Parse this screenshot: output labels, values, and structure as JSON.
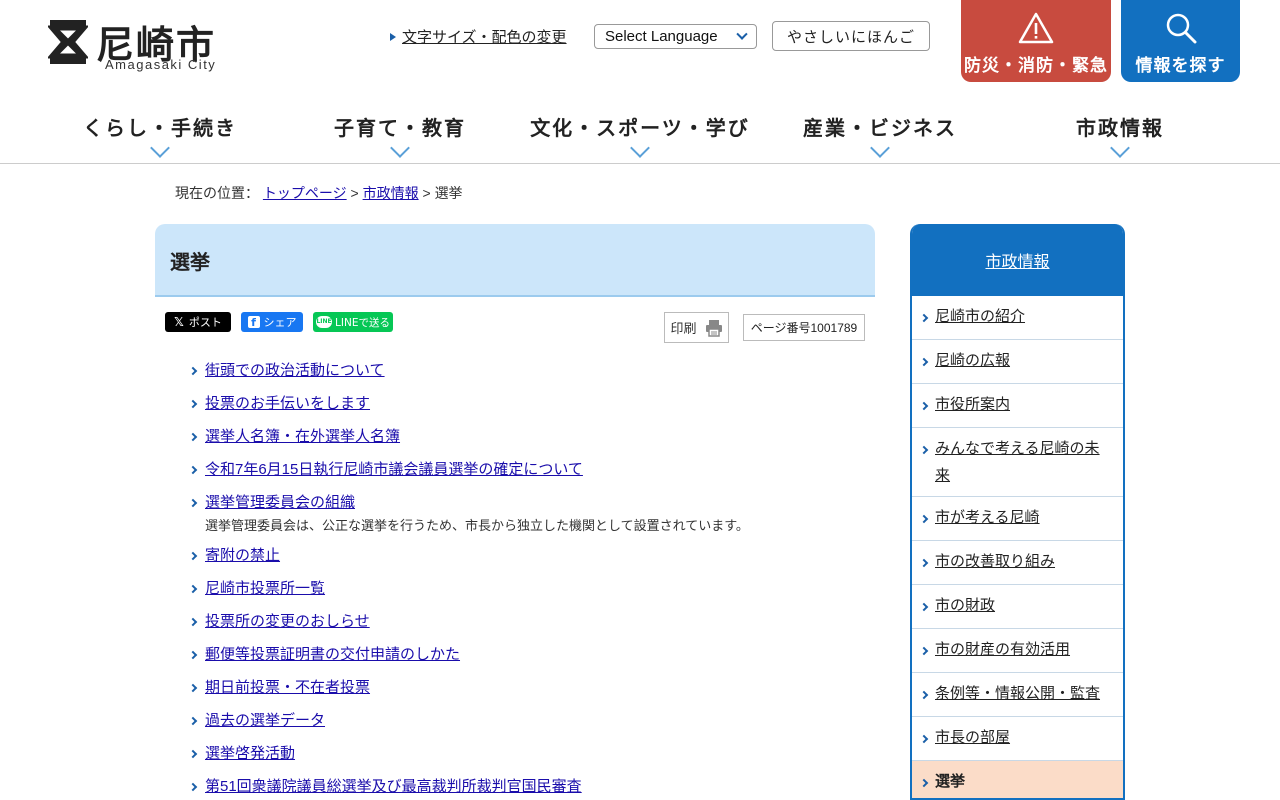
{
  "header": {
    "logo_text": "尼崎市",
    "logo_sub": "Amagasaki City",
    "textsize_link": "文字サイズ・配色の変更",
    "language_select": "Select Language",
    "easy_japanese": "やさしいにほんご",
    "disaster_button": "防災・消防・緊急",
    "search_button": "情報を探す",
    "disaster_color": "#c84b3f",
    "brand_blue": "#1270c0"
  },
  "gnav": [
    {
      "label": "くらし・手続き"
    },
    {
      "label": "子育て・教育"
    },
    {
      "label": "文化・スポーツ・学び"
    },
    {
      "label": "産業・ビジネス"
    },
    {
      "label": "市政情報"
    }
  ],
  "breadcrumb": {
    "prefix": "現在の位置：",
    "top": "トップページ",
    "sep": ">",
    "parent": "市政情報",
    "current": "選挙"
  },
  "main": {
    "title": "選挙",
    "share_x": "ポスト",
    "share_fb": "シェア",
    "share_line": "LINEで送る",
    "print": "印刷",
    "page_number": "ページ番号1001789",
    "links": [
      {
        "label": "街頭での政治活動について"
      },
      {
        "label": "投票のお手伝いをします"
      },
      {
        "label": "選挙人名簿・在外選挙人名簿"
      },
      {
        "label": "令和7年6月15日執行尼崎市議会議員選挙の確定について"
      },
      {
        "label": "選挙管理委員会の組織",
        "desc": "選挙管理委員会は、公正な選挙を行うため、市長から独立した機関として設置されています。"
      },
      {
        "label": "寄附の禁止"
      },
      {
        "label": "尼崎市投票所一覧"
      },
      {
        "label": "投票所の変更のおしらせ"
      },
      {
        "label": "郵便等投票証明書の交付申請のしかた"
      },
      {
        "label": "期日前投票・不在者投票"
      },
      {
        "label": "過去の選挙データ"
      },
      {
        "label": "選挙啓発活動"
      },
      {
        "label": "第51回衆議院議員総選挙及び最高裁判所裁判官国民審査"
      }
    ]
  },
  "sidebar": {
    "heading": "市政情報",
    "items": [
      {
        "label": "尼崎市の紹介"
      },
      {
        "label": "尼崎の広報"
      },
      {
        "label": "市役所案内"
      },
      {
        "label": "みんなで考える尼崎の未来"
      },
      {
        "label": "市が考える尼崎"
      },
      {
        "label": "市の改善取り組み"
      },
      {
        "label": "市の財政"
      },
      {
        "label": "市の財産の有効活用"
      },
      {
        "label": "条例等・情報公開・監査"
      },
      {
        "label": "市長の部屋"
      },
      {
        "label": "選挙"
      }
    ]
  }
}
